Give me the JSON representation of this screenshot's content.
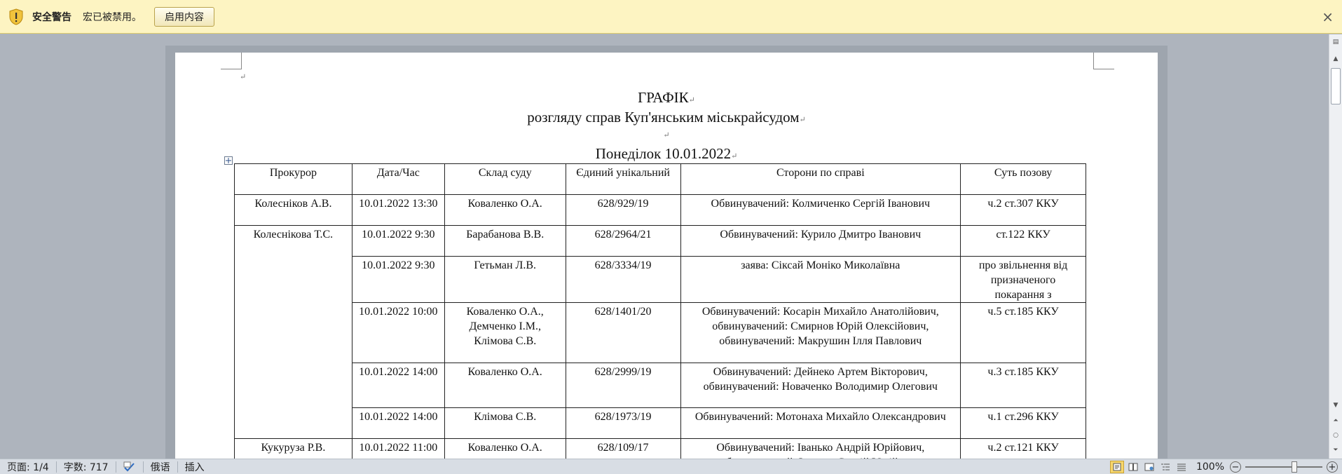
{
  "security_bar": {
    "title": "安全警告",
    "message": "宏已被禁用。",
    "enable_button": "启用内容",
    "close": "×"
  },
  "document": {
    "title": "ГРАФІК",
    "subtitle": "розгляду справ Куп'янським міськрайсудом",
    "day_heading": "Понеділок 10.01.2022",
    "table": {
      "headers": [
        "Прокурор",
        "Дата/Час",
        "Склад суду",
        "Єдиний унікальний",
        "Сторони по справі",
        "Суть позову"
      ],
      "rows": [
        {
          "prosecutor": "Колесніков А.В.",
          "datetime": "10.01.2022 13:30",
          "court": "Коваленко О.А.",
          "case": "628/929/19",
          "parties": "Обвинувачений: Колмиченко Сергій Іванович",
          "essence": "ч.2 ст.307 ККУ"
        },
        {
          "prosecutor": "Колеснікова Т.С.",
          "datetime": "10.01.2022 9:30",
          "court": "Барабанова В.В.",
          "case": "628/2964/21",
          "parties": "Обвинувачений: Курило Дмитро Іванович",
          "essence": "ст.122 ККУ"
        },
        {
          "prosecutor": "",
          "datetime": "10.01.2022 9:30",
          "court": "Гетьман Л.В.",
          "case": "628/3334/19",
          "parties": "заява: Сіксай Моніко Миколаївна",
          "essence": "про звільнення від призначеного покарання з"
        },
        {
          "prosecutor": "",
          "datetime": "10.01.2022 10:00",
          "court": "Коваленко О.А., Демченко І.М., Клімова С.В.",
          "case": "628/1401/20",
          "parties": "Обвинувачений: Косарін Михайло Анатолійович, обвинувачений: Смирнов Юрій Олексійович, обвинувачений: Макрушин Ілля Павлович",
          "essence": "ч.5 ст.185 ККУ"
        },
        {
          "prosecutor": "",
          "datetime": "10.01.2022 14:00",
          "court": "Коваленко О.А.",
          "case": "628/2999/19",
          "parties": "Обвинувачений: Дейнеко Артем Вікторович, обвинувачений: Новаченко Володимир Олегович",
          "essence": "ч.3 ст.185 ККУ"
        },
        {
          "prosecutor": "",
          "datetime": "10.01.2022 14:00",
          "court": "Клімова С.В.",
          "case": "628/1973/19",
          "parties": "Обвинувачений: Мотонаха Михайло Олександрович",
          "essence": "ч.1 ст.296 ККУ"
        },
        {
          "prosecutor": "Кукуруза Р.В.",
          "datetime": "10.01.2022 11:00",
          "court": "Коваленко О.А.",
          "case": "628/109/17",
          "parties": "Обвинувачений: Іванько Андрій Юрійович, обвинувачений: Іванько Сергій Юрійович",
          "essence": "ч.2 ст.121 ККУ"
        }
      ]
    }
  },
  "status_bar": {
    "page": "页面: 1/4",
    "words": "字数: 717",
    "language": "俄语",
    "mode": "插入",
    "zoom": "100%"
  },
  "icons": {
    "shield": "shield-warning-icon",
    "spellcheck": "spellcheck-icon",
    "view_print": "print-layout-icon",
    "view_fullscreen": "full-screen-reading-icon",
    "view_web": "web-layout-icon",
    "view_outline": "outline-icon",
    "view_draft": "draft-icon"
  },
  "colors": {
    "warning_bar": "#fdf4c2",
    "doc_background": "#aeb4bd",
    "active_view": "#f7d66b"
  }
}
